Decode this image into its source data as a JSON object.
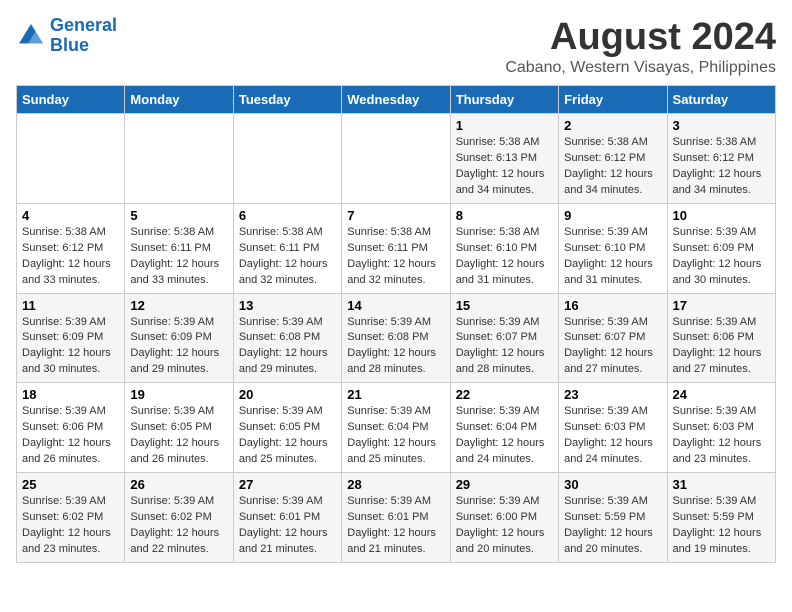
{
  "logo": {
    "line1": "General",
    "line2": "Blue"
  },
  "title": "August 2024",
  "subtitle": "Cabano, Western Visayas, Philippines",
  "days_of_week": [
    "Sunday",
    "Monday",
    "Tuesday",
    "Wednesday",
    "Thursday",
    "Friday",
    "Saturday"
  ],
  "weeks": [
    [
      {
        "day": "",
        "info": ""
      },
      {
        "day": "",
        "info": ""
      },
      {
        "day": "",
        "info": ""
      },
      {
        "day": "",
        "info": ""
      },
      {
        "day": "1",
        "info": "Sunrise: 5:38 AM\nSunset: 6:13 PM\nDaylight: 12 hours\nand 34 minutes."
      },
      {
        "day": "2",
        "info": "Sunrise: 5:38 AM\nSunset: 6:12 PM\nDaylight: 12 hours\nand 34 minutes."
      },
      {
        "day": "3",
        "info": "Sunrise: 5:38 AM\nSunset: 6:12 PM\nDaylight: 12 hours\nand 34 minutes."
      }
    ],
    [
      {
        "day": "4",
        "info": "Sunrise: 5:38 AM\nSunset: 6:12 PM\nDaylight: 12 hours\nand 33 minutes."
      },
      {
        "day": "5",
        "info": "Sunrise: 5:38 AM\nSunset: 6:11 PM\nDaylight: 12 hours\nand 33 minutes."
      },
      {
        "day": "6",
        "info": "Sunrise: 5:38 AM\nSunset: 6:11 PM\nDaylight: 12 hours\nand 32 minutes."
      },
      {
        "day": "7",
        "info": "Sunrise: 5:38 AM\nSunset: 6:11 PM\nDaylight: 12 hours\nand 32 minutes."
      },
      {
        "day": "8",
        "info": "Sunrise: 5:38 AM\nSunset: 6:10 PM\nDaylight: 12 hours\nand 31 minutes."
      },
      {
        "day": "9",
        "info": "Sunrise: 5:39 AM\nSunset: 6:10 PM\nDaylight: 12 hours\nand 31 minutes."
      },
      {
        "day": "10",
        "info": "Sunrise: 5:39 AM\nSunset: 6:09 PM\nDaylight: 12 hours\nand 30 minutes."
      }
    ],
    [
      {
        "day": "11",
        "info": "Sunrise: 5:39 AM\nSunset: 6:09 PM\nDaylight: 12 hours\nand 30 minutes."
      },
      {
        "day": "12",
        "info": "Sunrise: 5:39 AM\nSunset: 6:09 PM\nDaylight: 12 hours\nand 29 minutes."
      },
      {
        "day": "13",
        "info": "Sunrise: 5:39 AM\nSunset: 6:08 PM\nDaylight: 12 hours\nand 29 minutes."
      },
      {
        "day": "14",
        "info": "Sunrise: 5:39 AM\nSunset: 6:08 PM\nDaylight: 12 hours\nand 28 minutes."
      },
      {
        "day": "15",
        "info": "Sunrise: 5:39 AM\nSunset: 6:07 PM\nDaylight: 12 hours\nand 28 minutes."
      },
      {
        "day": "16",
        "info": "Sunrise: 5:39 AM\nSunset: 6:07 PM\nDaylight: 12 hours\nand 27 minutes."
      },
      {
        "day": "17",
        "info": "Sunrise: 5:39 AM\nSunset: 6:06 PM\nDaylight: 12 hours\nand 27 minutes."
      }
    ],
    [
      {
        "day": "18",
        "info": "Sunrise: 5:39 AM\nSunset: 6:06 PM\nDaylight: 12 hours\nand 26 minutes."
      },
      {
        "day": "19",
        "info": "Sunrise: 5:39 AM\nSunset: 6:05 PM\nDaylight: 12 hours\nand 26 minutes."
      },
      {
        "day": "20",
        "info": "Sunrise: 5:39 AM\nSunset: 6:05 PM\nDaylight: 12 hours\nand 25 minutes."
      },
      {
        "day": "21",
        "info": "Sunrise: 5:39 AM\nSunset: 6:04 PM\nDaylight: 12 hours\nand 25 minutes."
      },
      {
        "day": "22",
        "info": "Sunrise: 5:39 AM\nSunset: 6:04 PM\nDaylight: 12 hours\nand 24 minutes."
      },
      {
        "day": "23",
        "info": "Sunrise: 5:39 AM\nSunset: 6:03 PM\nDaylight: 12 hours\nand 24 minutes."
      },
      {
        "day": "24",
        "info": "Sunrise: 5:39 AM\nSunset: 6:03 PM\nDaylight: 12 hours\nand 23 minutes."
      }
    ],
    [
      {
        "day": "25",
        "info": "Sunrise: 5:39 AM\nSunset: 6:02 PM\nDaylight: 12 hours\nand 23 minutes."
      },
      {
        "day": "26",
        "info": "Sunrise: 5:39 AM\nSunset: 6:02 PM\nDaylight: 12 hours\nand 22 minutes."
      },
      {
        "day": "27",
        "info": "Sunrise: 5:39 AM\nSunset: 6:01 PM\nDaylight: 12 hours\nand 21 minutes."
      },
      {
        "day": "28",
        "info": "Sunrise: 5:39 AM\nSunset: 6:01 PM\nDaylight: 12 hours\nand 21 minutes."
      },
      {
        "day": "29",
        "info": "Sunrise: 5:39 AM\nSunset: 6:00 PM\nDaylight: 12 hours\nand 20 minutes."
      },
      {
        "day": "30",
        "info": "Sunrise: 5:39 AM\nSunset: 5:59 PM\nDaylight: 12 hours\nand 20 minutes."
      },
      {
        "day": "31",
        "info": "Sunrise: 5:39 AM\nSunset: 5:59 PM\nDaylight: 12 hours\nand 19 minutes."
      }
    ]
  ]
}
